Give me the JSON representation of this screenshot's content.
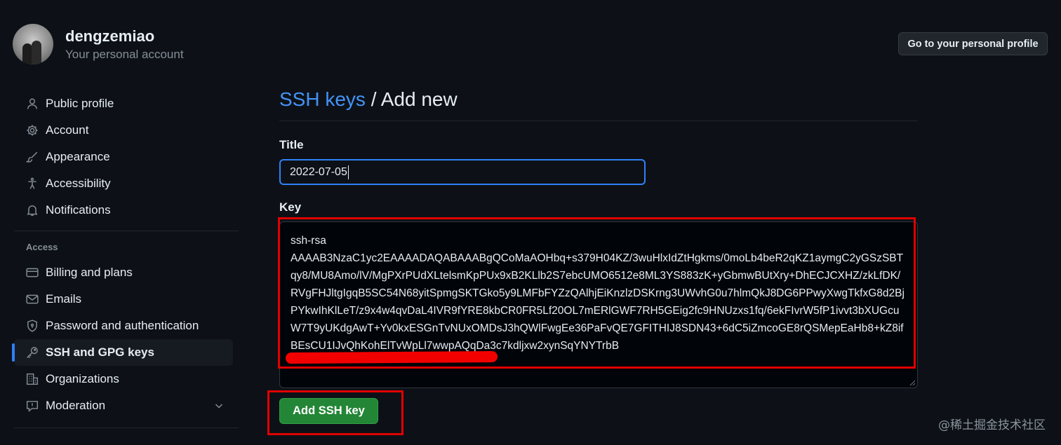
{
  "account": {
    "username": "dengzemiao",
    "subtitle": "Your personal account",
    "profile_button": "Go to your personal profile"
  },
  "sidebar": {
    "items": [
      {
        "label": "Public profile",
        "icon": "person-icon"
      },
      {
        "label": "Account",
        "icon": "gear-icon"
      },
      {
        "label": "Appearance",
        "icon": "paintbrush-icon"
      },
      {
        "label": "Accessibility",
        "icon": "accessibility-icon"
      },
      {
        "label": "Notifications",
        "icon": "bell-icon"
      }
    ],
    "access_heading": "Access",
    "access_items": [
      {
        "label": "Billing and plans",
        "icon": "credit-card-icon"
      },
      {
        "label": "Emails",
        "icon": "mail-icon"
      },
      {
        "label": "Password and authentication",
        "icon": "shield-lock-icon"
      },
      {
        "label": "SSH and GPG keys",
        "icon": "key-icon",
        "active": true
      },
      {
        "label": "Organizations",
        "icon": "organization-icon"
      },
      {
        "label": "Moderation",
        "icon": "report-icon"
      }
    ]
  },
  "main": {
    "breadcrumb_link": "SSH keys",
    "breadcrumb_sep": " / ",
    "breadcrumb_current": "Add new",
    "title_label": "Title",
    "title_value": "2022-07-05",
    "key_label": "Key",
    "key_value": "ssh-rsa\nAAAAB3NzaC1yc2EAAAADAQABAAABgQCoMaAOHbq+s379H04KZ/3wuHlxIdZtHgkms/0moLb4beR2qKZ1aymgC2yGSzSBTqy8/MU8Amo/lV/MgPXrPUdXLtelsmKpPUx9xB2KLlb2S7ebcUMO6512e8ML3YS883zK+yGbmwBUtXry+DhECJCXHZ/zkLfDK/RVgFHJltgIgqB5SC54N68yitSpmgSKTGko5y9LMFbFYZzQAlhjEiKnzlzDSKrng3UWvhG0u7hlmQkJ8DG6PPwyXwgTkfxG8d2BjPYkwIhKlLeT/z9x4w4qvDaL4IVR9fYRE8kbCR0FR5Lf20OL7mERlGWF7RH5GEig2fc9HNUzxs1fq/6ekFIvrW5fP1ivvt3bXUGcuW7T9yUKdgAwT+Yv0kxESGnTvNUxOMDsJ3hQWlFwgEe36PaFvQE7GFITHIJ8SDN43+6dC5iZmcoGE8rQSMepEaHb8+kZ8ifBEsCU1IJvQhKohElTvWpLl7wwpAQqDa3c7kdljxw2xynSqYNYTrbB",
    "submit_label": "Add SSH key"
  },
  "watermark": "@稀土掘金技术社区",
  "colors": {
    "background": "#0d1117",
    "link": "#4493f8",
    "focus_border": "#2f81f7",
    "primary_button": "#238636",
    "annotation_red": "#e00000"
  }
}
